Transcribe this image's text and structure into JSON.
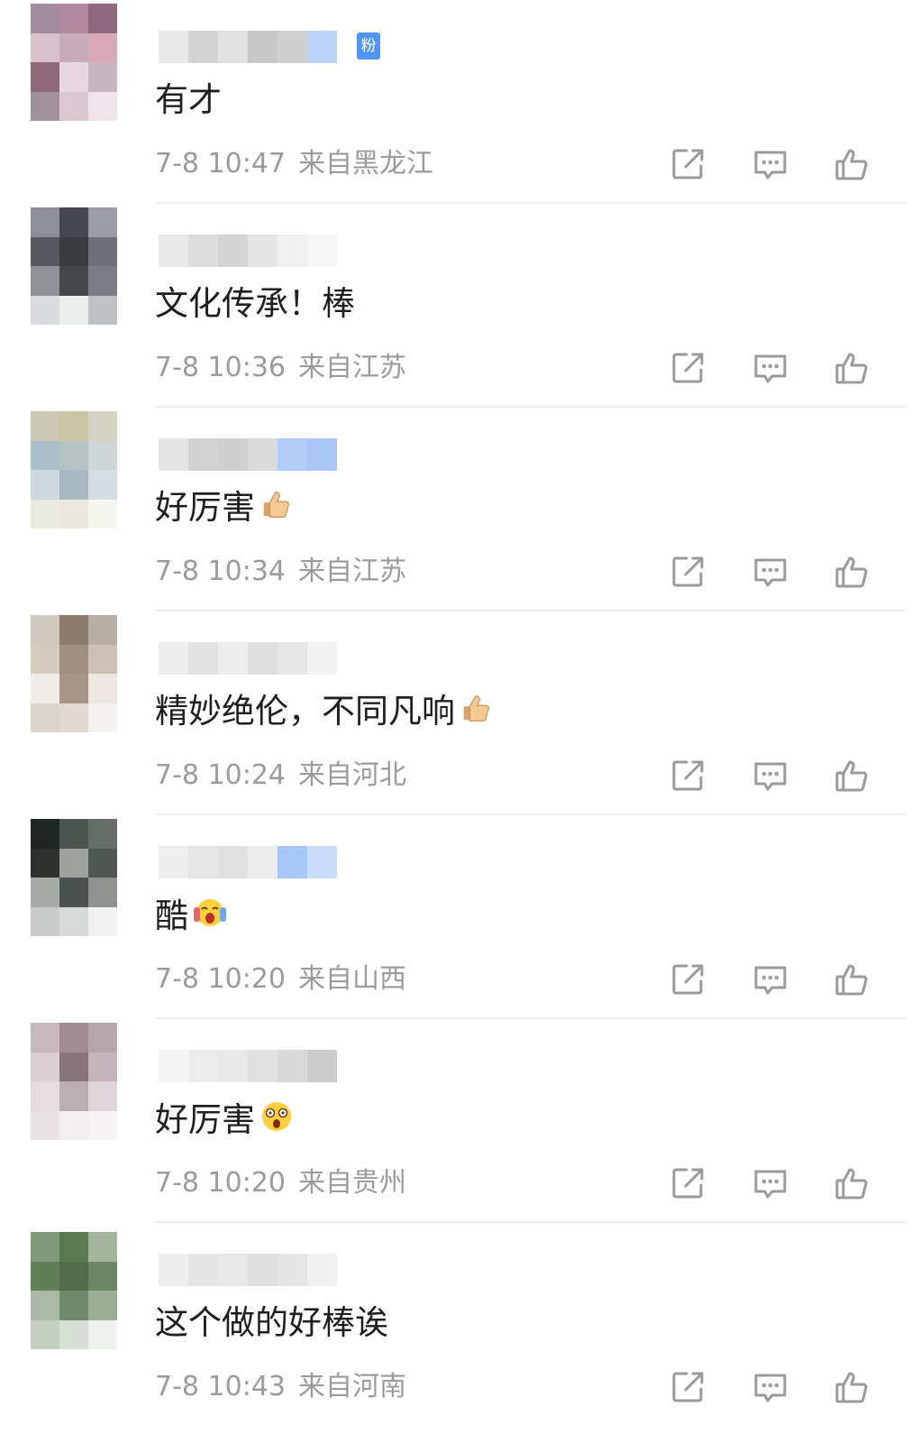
{
  "comments": [
    {
      "text": "有才",
      "time": "7-8 10:47",
      "location": "来自黑龙江",
      "emoji": "",
      "fan_badge": "粉",
      "avatar_colors": [
        "#a48c9c",
        "#b08a9c",
        "#8f6a7d",
        "#d8c2cc",
        "#c9aab8",
        "#d9a8b8",
        "#8e6a78",
        "#e7d8df",
        "#c6b4be",
        "#a0919b",
        "#dcc6cf",
        "#f0e4ea"
      ],
      "name_colors": [
        "#e9e9e9",
        "#d3d3d3",
        "#e1e1e1",
        "#c7c7c7",
        "#cfcfcf",
        "#bcd3fa"
      ]
    },
    {
      "text": "文化传承！棒",
      "time": "7-8 10:36",
      "location": "来自江苏",
      "emoji": "",
      "fan_badge": "",
      "avatar_colors": [
        "#8c8f95",
        "#45484c",
        "#9a9ea4",
        "#55585d",
        "#3a3c40",
        "#6d7176",
        "#8f9297",
        "#45474b",
        "#7a7e83",
        "#d8dadd",
        "#eceded",
        "#bfc2c5"
      ],
      "name_colors": [
        "#e8e8e8",
        "#dcdcdc",
        "#d4d4d4",
        "#e4e4e4",
        "#f0f0f0",
        "#f6f6f6"
      ]
    },
    {
      "text": "好厉害",
      "time": "7-8 10:34",
      "location": "来自江苏",
      "emoji": "thumbs-up",
      "fan_badge": "",
      "avatar_colors": [
        "#cbc9b4",
        "#c8c6a5",
        "#d3d2c0",
        "#a9bfc9",
        "#b7c3c3",
        "#cfd6d8",
        "#cdd9df",
        "#a6b8c0",
        "#d3dde2",
        "#e9ebe1",
        "#eae8dc",
        "#f5f5ef"
      ],
      "name_colors": [
        "#e4e4e4",
        "#d2d2d2",
        "#cfcfcf",
        "#dadada",
        "#b1ccf8",
        "#a9c6f6"
      ]
    },
    {
      "text": "精妙绝伦，不同凡响",
      "time": "7-8 10:24",
      "location": "来自河北",
      "emoji": "thumbs-up",
      "fan_badge": "",
      "avatar_colors": [
        "#cfc8bd",
        "#8c7b6c",
        "#b8aea3",
        "#d6cbbf",
        "#a18f80",
        "#cdbfb4",
        "#efece7",
        "#a89585",
        "#ece7e0",
        "#d9d4cd",
        "#e0dad3",
        "#f4f2ef"
      ],
      "name_colors": [
        "#eeeeee",
        "#e2e2e2",
        "#ececec",
        "#dedede",
        "#e6e6e6",
        "#f2f2f2"
      ]
    },
    {
      "text": "酷",
      "time": "7-8 10:20",
      "location": "来自山西",
      "emoji": "scream",
      "fan_badge": "",
      "avatar_colors": [
        "#1f2522",
        "#4d5450",
        "#676d69",
        "#2b322e",
        "#9da29f",
        "#505753",
        "#a6aba8",
        "#4b514e",
        "#8e938f",
        "#c8cbc9",
        "#d8dad9",
        "#f0f1f0"
      ],
      "name_colors": [
        "#eeeeee",
        "#e6e6e6",
        "#e0e0e0",
        "#ececec",
        "#a8c6f7",
        "#c9dcfa"
      ]
    },
    {
      "text": "好厉害",
      "time": "7-8 10:20",
      "location": "来自贵州",
      "emoji": "scared",
      "fan_badge": "",
      "avatar_colors": [
        "#c7b8be",
        "#9f8d93",
        "#b5a6ac",
        "#dccfd4",
        "#86747a",
        "#c2b4ba",
        "#e6dde1",
        "#b9aeb2",
        "#ded6da",
        "#e8e1e4",
        "#f2edef",
        "#f7f4f5"
      ],
      "name_colors": [
        "#f4f4f4",
        "#ececec",
        "#e8e8e8",
        "#e0e0e0",
        "#d8d8d8",
        "#cccccc"
      ]
    },
    {
      "text": "这个做的好棒诶",
      "time": "7-8 10:43",
      "location": "来自河南",
      "emoji": "",
      "fan_badge": "",
      "avatar_colors": [
        "#7e9a78",
        "#5a7a52",
        "#a3b59d",
        "#5f7f57",
        "#4f6d48",
        "#6a8862",
        "#a9b9a5",
        "#6f8b69",
        "#9aae95",
        "#c3cfbf",
        "#d6dfd3",
        "#eef2ec"
      ],
      "name_colors": [
        "#eeeeee",
        "#e4e4e4",
        "#e8e8e8",
        "#dedede",
        "#e4e4e4",
        "#f0f0f0"
      ]
    }
  ],
  "icons": {
    "share": "share-icon",
    "comment": "comment-icon",
    "like": "thumbs-up-icon"
  },
  "colors": {
    "meta": "#9b9b9b",
    "text": "#1f1f1f",
    "icon": "#9a9a9a",
    "fan_badge": "#4f95f5",
    "divider": "#eeeeee"
  }
}
